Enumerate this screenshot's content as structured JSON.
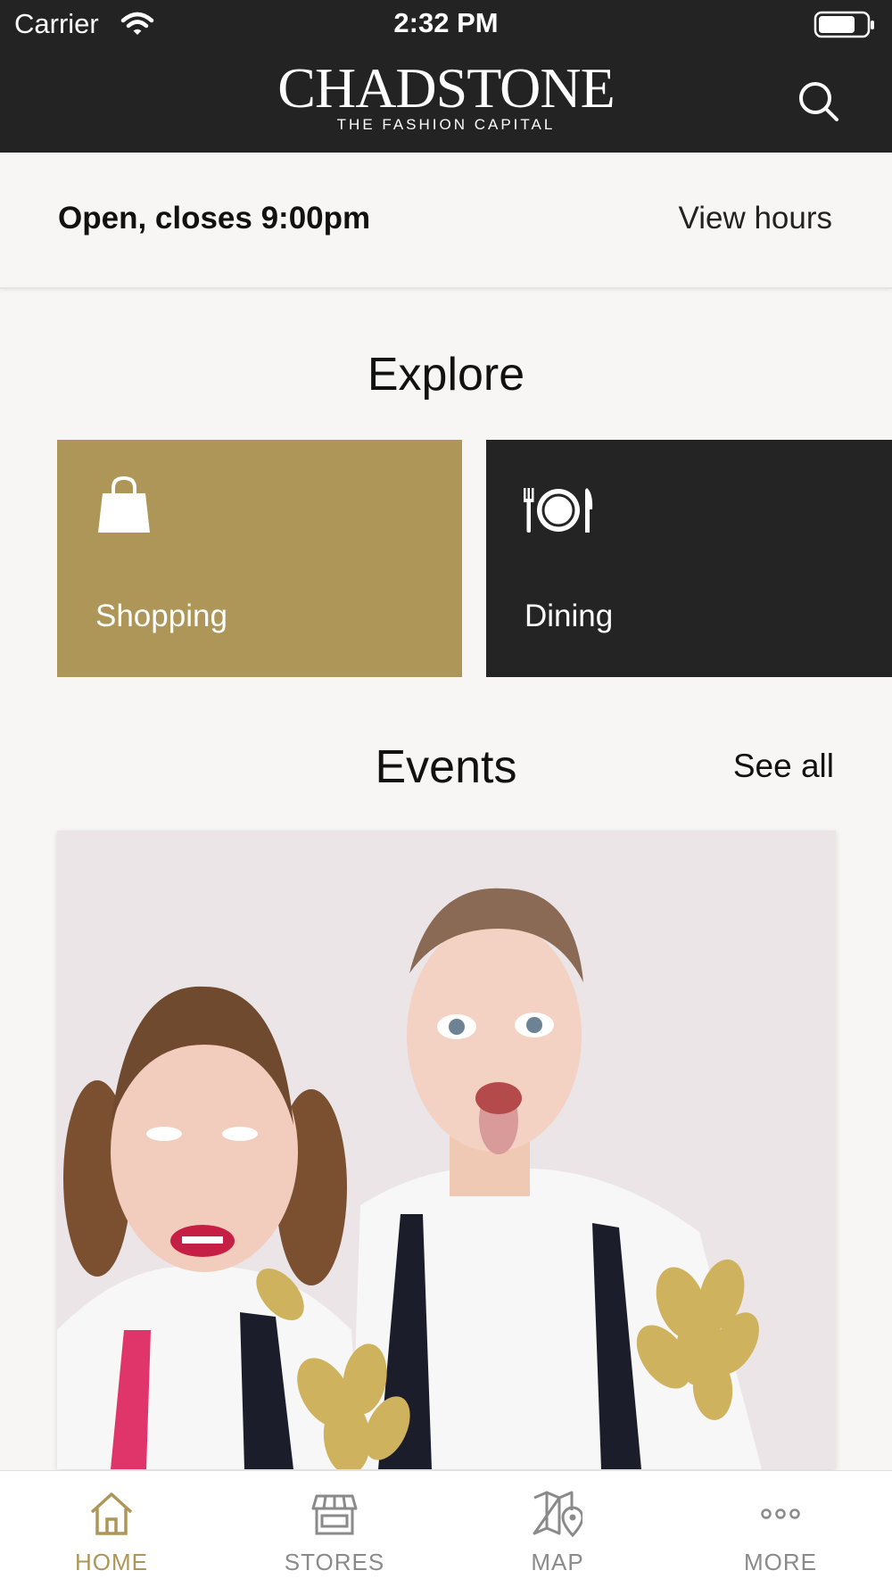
{
  "status_bar": {
    "carrier": "Carrier",
    "time": "2:32 PM"
  },
  "header": {
    "logo_title": "CHADSTONE",
    "logo_subtitle": "THE FASHION CAPITAL",
    "search_icon": "search-icon"
  },
  "hours": {
    "status": "Open, closes 9:00pm",
    "view_hours": "View hours"
  },
  "explore": {
    "title": "Explore",
    "tiles": [
      {
        "label": "Shopping",
        "icon": "shopping-bag-icon",
        "color": "#ad9657"
      },
      {
        "label": "Dining",
        "icon": "cutlery-plate-icon",
        "color": "#242424"
      }
    ]
  },
  "events": {
    "title": "Events",
    "see_all": "See all"
  },
  "tabbar": {
    "items": [
      {
        "label": "HOME",
        "icon": "home-icon",
        "active": true
      },
      {
        "label": "STORES",
        "icon": "store-icon",
        "active": false
      },
      {
        "label": "MAP",
        "icon": "map-icon",
        "active": false
      },
      {
        "label": "MORE",
        "icon": "more-icon",
        "active": false
      }
    ],
    "active_color": "#ad9657",
    "inactive_color": "#8a8a8a"
  }
}
